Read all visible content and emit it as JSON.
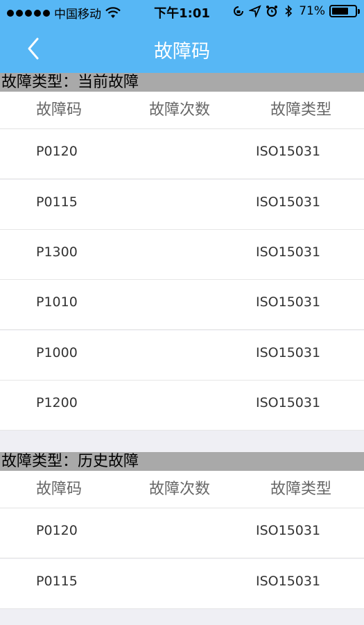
{
  "status_bar": {
    "carrier": "中国移动",
    "time": "下午1:01",
    "battery": "71%",
    "battery_level": 0.71,
    "icons": [
      "signal-dots-icon",
      "wifi-icon",
      "rotation-lock-icon",
      "location-arrow-icon",
      "alarm-icon",
      "bluetooth-icon",
      "battery-icon"
    ]
  },
  "nav": {
    "title": "故障码",
    "back_icon": "chevron-left-icon"
  },
  "colors": {
    "nav_bg": "#57b7f5",
    "section_header_bg": "#a9a9a9",
    "page_bg": "#efeff4"
  },
  "columns": [
    "故障码",
    "故障次数",
    "故障类型"
  ],
  "sections": [
    {
      "title": "故障类型：当前故障",
      "rows": [
        {
          "code": "P0120",
          "count": "",
          "type": "ISO15031"
        },
        {
          "code": "P0115",
          "count": "",
          "type": "ISO15031"
        },
        {
          "code": "P1300",
          "count": "",
          "type": "ISO15031"
        },
        {
          "code": "P1010",
          "count": "",
          "type": "ISO15031"
        },
        {
          "code": "P1000",
          "count": "",
          "type": "ISO15031"
        },
        {
          "code": "P1200",
          "count": "",
          "type": "ISO15031"
        }
      ]
    },
    {
      "title": "故障类型：历史故障",
      "rows": [
        {
          "code": "P0120",
          "count": "",
          "type": "ISO15031"
        },
        {
          "code": "P0115",
          "count": "",
          "type": "ISO15031"
        }
      ]
    }
  ]
}
